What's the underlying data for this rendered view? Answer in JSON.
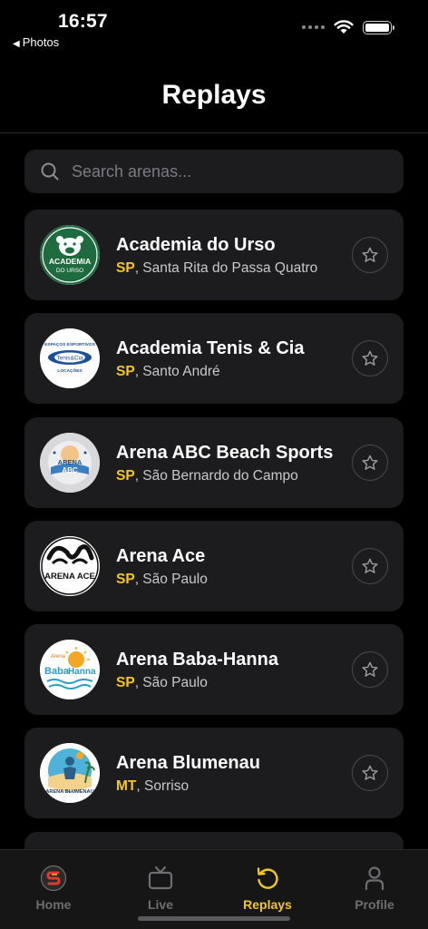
{
  "status": {
    "time": "16:57",
    "back_app": "Photos"
  },
  "header": {
    "title": "Replays"
  },
  "search": {
    "placeholder": "Search arenas..."
  },
  "arenas": [
    {
      "name": "Academia do Urso",
      "state": "SP",
      "city": ", Santa Rita do Passa Quatro",
      "logo": "academia-do-urso-logo"
    },
    {
      "name": "Academia Tenis & Cia",
      "state": "SP",
      "city": ", Santo André",
      "logo": "tenis-e-cia-logo"
    },
    {
      "name": "Arena ABC Beach Sports",
      "state": "SP",
      "city": ", São Bernardo do Campo",
      "logo": "arena-abc-logo"
    },
    {
      "name": "Arena Ace",
      "state": "SP",
      "city": ", São Paulo",
      "logo": "arena-ace-logo"
    },
    {
      "name": "Arena Baba-Hanna",
      "state": "SP",
      "city": ", São Paulo",
      "logo": "arena-baba-hanna-logo"
    },
    {
      "name": "Arena Blumenau",
      "state": "MT",
      "city": ", Sorriso",
      "logo": "arena-blumenau-logo"
    }
  ],
  "logo_text": {
    "urso_1": "ACADEMIA",
    "urso_2": "DO URSO",
    "tenis_top": "ESPAÇOS ESPORTIVOS",
    "tenis_mid": "Tenis&Cia",
    "tenis_bot": "LOCAÇÕES",
    "abc_1": "ARENA",
    "abc_2": "ABC",
    "ace": "ARENA ACE",
    "baba_1": "Arena",
    "baba_2": "Baba",
    "baba_3": "Hanna",
    "blumenau": "ARENA BLUMENAU"
  },
  "tabs": [
    {
      "label": "Home",
      "icon": "home-logo-icon",
      "active": false
    },
    {
      "label": "Live",
      "icon": "tv-icon",
      "active": false
    },
    {
      "label": "Replays",
      "icon": "replay-icon",
      "active": true
    },
    {
      "label": "Profile",
      "icon": "person-icon",
      "active": false
    }
  ],
  "colors": {
    "accent": "#f6c814",
    "card": "#1c1c1e",
    "background": "#000000"
  }
}
